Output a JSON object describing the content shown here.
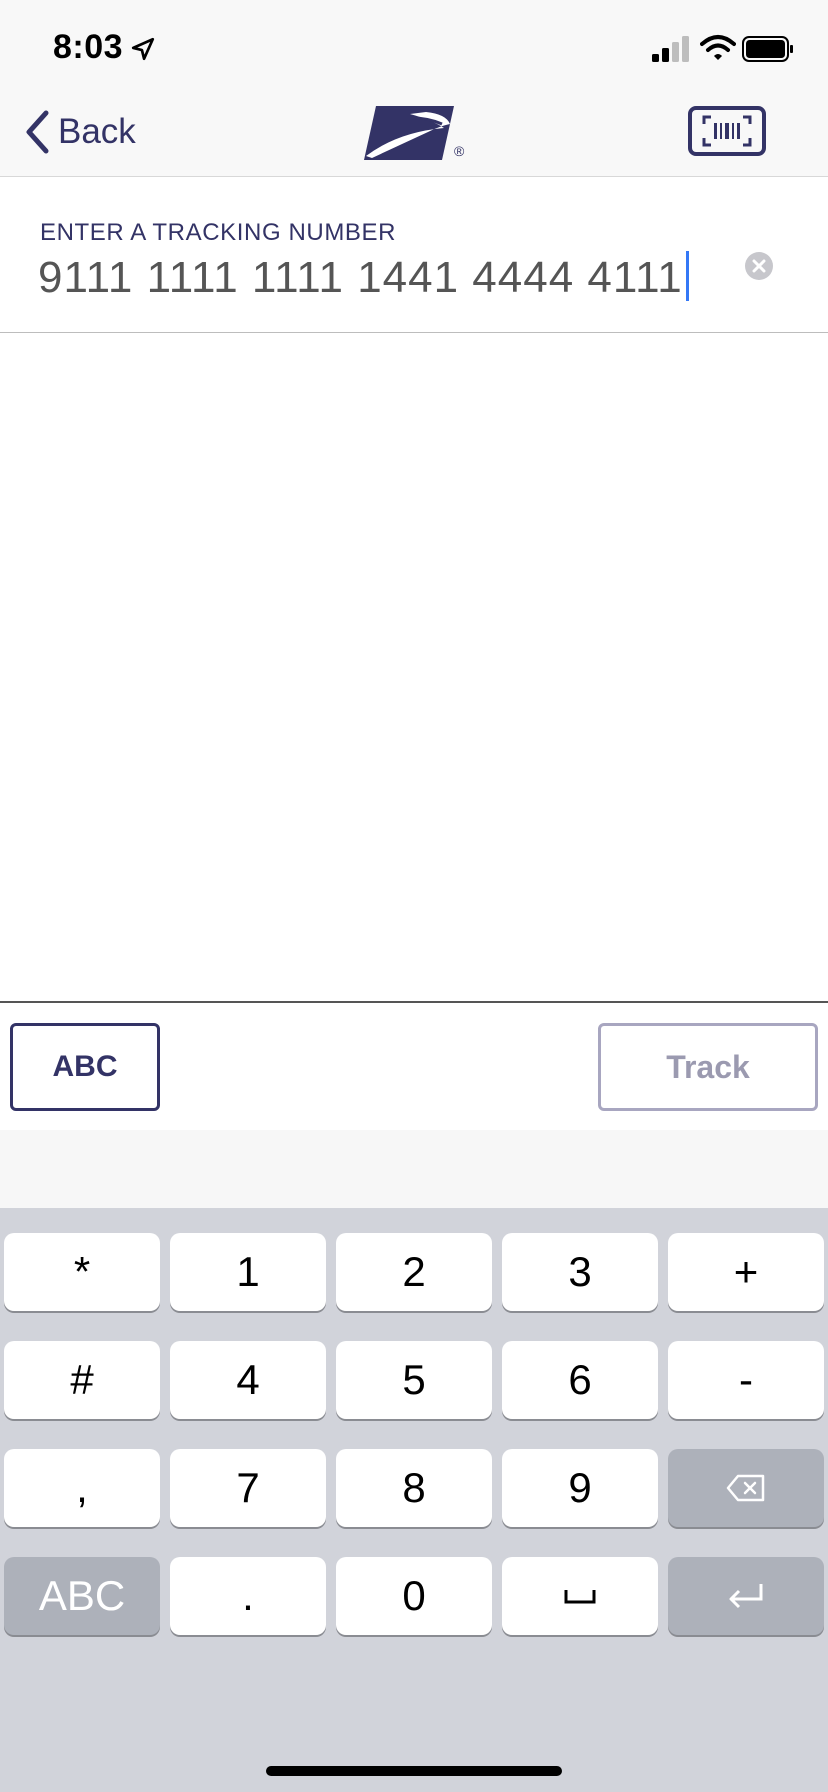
{
  "status_bar": {
    "time": "8:03"
  },
  "nav": {
    "back_label": "Back",
    "logo_registered": "®"
  },
  "tracking": {
    "label": "ENTER A TRACKING NUMBER",
    "value": "9111 1111 1111 1441 4444 4111"
  },
  "actions": {
    "abc_label": "ABC",
    "track_label": "Track"
  },
  "keyboard": {
    "row1": [
      "*",
      "1",
      "2",
      "3",
      "+"
    ],
    "row2": [
      "#",
      "4",
      "5",
      "6",
      "-"
    ],
    "row3": [
      ",",
      "7",
      "8",
      "9"
    ],
    "row4": [
      "ABC",
      ".",
      "0"
    ]
  },
  "colors": {
    "brand": "#333366",
    "caret": "#3478f6",
    "keyboard_bg": "#d1d3da"
  }
}
